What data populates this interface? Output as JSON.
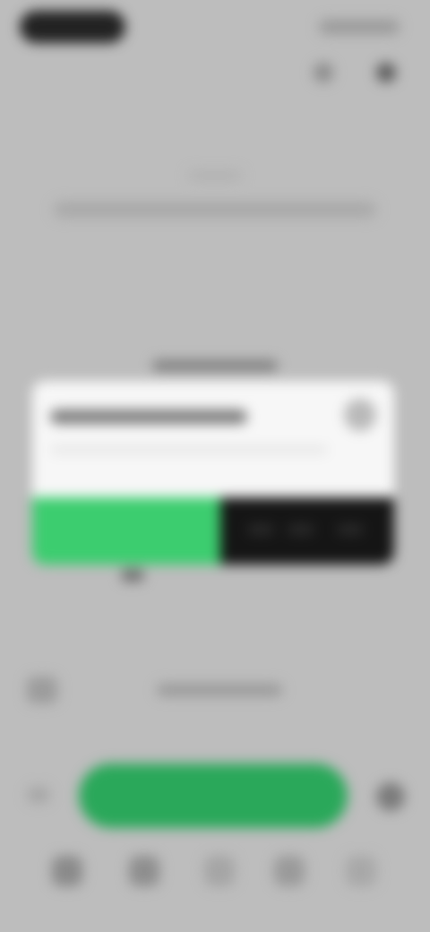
{
  "status_bar": {
    "time": "",
    "system": ""
  },
  "header": {
    "title": "",
    "subtitle": ""
  },
  "cta": {
    "title": ""
  },
  "card": {
    "title": "",
    "body": ""
  },
  "player": {
    "label": ""
  },
  "primary_action": {
    "label": ""
  },
  "colors": {
    "background": "#bdbdbd",
    "card_surface": "#f3f3f3",
    "accent_green": "#3ccd6f",
    "primary_button_green": "#2aa85a",
    "dark_band": "#151515"
  },
  "icons": {
    "top_left": "profile-icon",
    "top_right": "settings-icon",
    "card_action": "help-icon",
    "tabs": [
      "home-icon",
      "library-icon",
      "search-icon",
      "activity-icon",
      "more-icon"
    ]
  }
}
